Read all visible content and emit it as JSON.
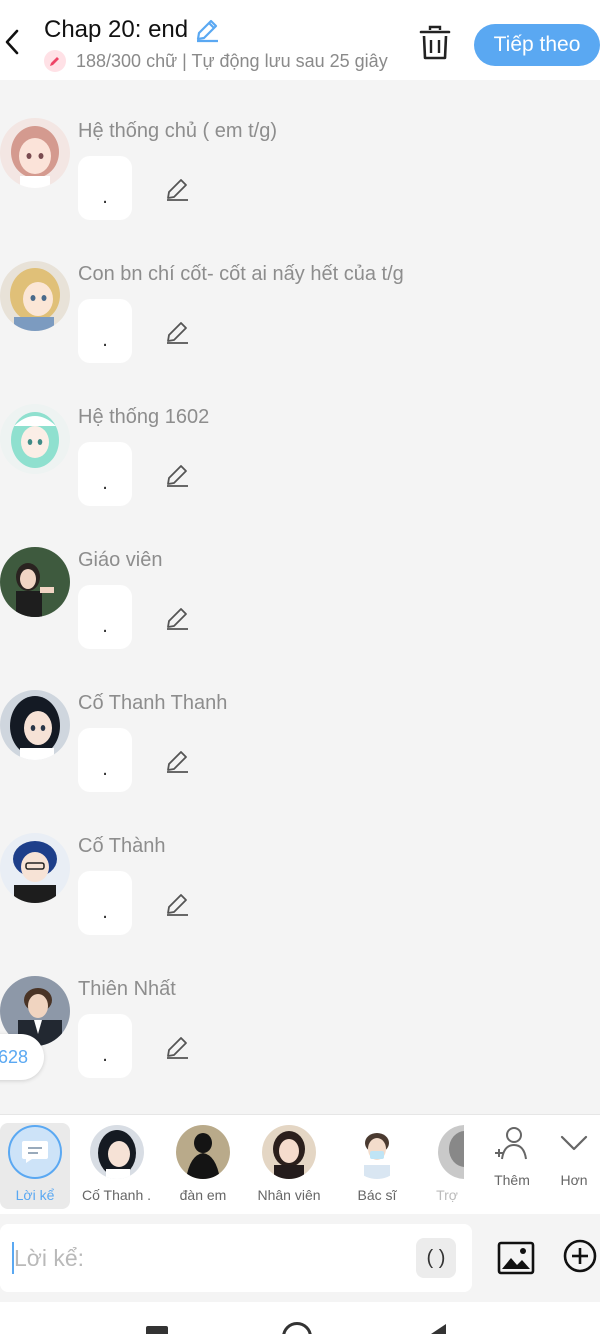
{
  "header": {
    "title": "Chap 20: end",
    "subtitle": "188/300 chữ | Tự động lưu sau 25 giây",
    "next_label": "Tiếp theo"
  },
  "messages": [
    {
      "name": "Hệ thống chủ ( em t/g)",
      "text": "."
    },
    {
      "name": "Con bn chí cốt- cốt ai nấy hết của t/g",
      "text": "."
    },
    {
      "name": "Hệ thống 1602",
      "text": "."
    },
    {
      "name": "Giáo viên",
      "text": "."
    },
    {
      "name": "Cố Thanh Thanh",
      "text": "."
    },
    {
      "name": "Cố Thành",
      "text": "."
    },
    {
      "name": "Thiên Nhất",
      "text": "."
    }
  ],
  "float_badge": "628",
  "characters": [
    {
      "label": "Lời kể"
    },
    {
      "label": "Cố Thanh ..."
    },
    {
      "label": "đàn em"
    },
    {
      "label": "Nhân viên"
    },
    {
      "label": "Bác sĩ"
    },
    {
      "label": "Trợ"
    }
  ],
  "tools": {
    "more_label": "Thêm",
    "expand_label": "Hơn"
  },
  "input": {
    "placeholder": "Lời kể:",
    "paren_label": "( )"
  },
  "colors": {
    "accent": "#5aa8f2",
    "background": "#f4f4f4"
  }
}
